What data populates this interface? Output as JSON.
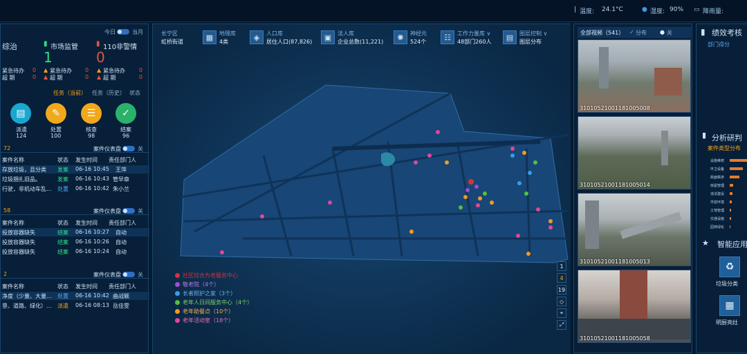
{
  "weather": {
    "temp_label": "温度:",
    "temp": "24.1°C",
    "humidity_label": "湿度:",
    "humidity": "90%",
    "rain_label": "降雨量:"
  },
  "left": {
    "today": "今日",
    "month": "当月",
    "cat1": "综治",
    "cat2": "市场监管",
    "cat3": "110非警情",
    "cat2_value": "1",
    "cat3_value": "0",
    "urgent": "紧急待办",
    "overdue": "超 期",
    "zero": "0",
    "tabs": {
      "current": "任务（当前）",
      "history": "任务（历史）",
      "state": "状态"
    },
    "stages": [
      {
        "label": "派遣",
        "value": "124",
        "color": "#1aa7cf",
        "icon": "document-icon"
      },
      {
        "label": "处置",
        "value": "100",
        "color": "#f2a81c",
        "icon": "wrench-icon"
      },
      {
        "label": "核查",
        "value": "98",
        "color": "#f2a81c",
        "icon": "checklist-icon"
      },
      {
        "label": "结案",
        "value": "96",
        "color": "#2bb26a",
        "icon": "check-icon"
      }
    ],
    "dash_label": "案件仪表盘",
    "off": "关",
    "sections": [
      {
        "count": "72",
        "headers": [
          "案件名称",
          "状态",
          "发生时间",
          "责任部门人"
        ],
        "rows": [
          [
            "存放垃圾，且分类",
            "发案",
            "06-16 10:45",
            "王萍"
          ],
          [
            "垃圾捆扎旧品。",
            "发案",
            "06-16 10:43",
            "管早章"
          ],
          [
            "行驶，非机动车乱...",
            "处置",
            "06-16 10:42",
            "朱小兰"
          ]
        ]
      },
      {
        "count": "58",
        "headers": [
          "案件名称",
          "状态",
          "发生时间",
          "责任部门人"
        ],
        "rows": [
          [
            "投放容器缺失",
            "结案",
            "06-16 10:27",
            "自动"
          ],
          [
            "投放容器缺失",
            "结案",
            "06-16 10:26",
            "自动"
          ],
          [
            "投放容器缺失",
            "结案",
            "06-16 10:24",
            "自动"
          ]
        ]
      },
      {
        "count": "2",
        "headers": [
          "案件名称",
          "状态",
          "发生时间",
          "责任部门人"
        ],
        "rows": [
          [
            "净度（少量、大量...",
            "处置",
            "06-16 10:42",
            "曲战颖"
          ],
          [
            "垦、道路、绿化）...",
            "派遣",
            "06-16 08:13",
            "岳佳雯"
          ]
        ]
      }
    ]
  },
  "map": {
    "district": "长宁区",
    "street": "虹桥街道",
    "stats": [
      {
        "title": "地理库",
        "value": "4类",
        "icon": "map-layer-icon"
      },
      {
        "title": "人口库",
        "value": "居住人口(87,826)",
        "icon": "population-icon"
      },
      {
        "title": "法人库",
        "value": "企业总数(11,221)",
        "icon": "company-icon"
      },
      {
        "title": "神经元",
        "value": "524个",
        "icon": "neuron-icon"
      },
      {
        "title": "工作力量库 ∨",
        "value": "48部门260人",
        "icon": "workforce-icon"
      },
      {
        "title": "图层控制 ∨",
        "value": "图层分布",
        "icon": "layers-icon"
      }
    ],
    "legend": [
      {
        "label": "社区综合为老服务中心",
        "color": "#d8313a"
      },
      {
        "label": "敬老院（4个）",
        "color": "#9b4fd1"
      },
      {
        "label": "长者照护之家（3个）",
        "color": "#3a9be6"
      },
      {
        "label": "老年人日间服务中心（4个）",
        "color": "#52c23a"
      },
      {
        "label": "老年助餐点（10个）",
        "color": "#f29a1f"
      },
      {
        "label": "老年活动室（18个）",
        "color": "#e0479b"
      }
    ],
    "zoom": [
      "1",
      "4",
      "19"
    ]
  },
  "cams": {
    "tab_all": "全部视频（541）",
    "tab_dist": "分布",
    "tab_off": "关",
    "items": [
      {
        "label": "31010521001181005008"
      },
      {
        "label": "31010521001181005014"
      },
      {
        "label": "31010521001181005013"
      },
      {
        "label": "31010521001181005058"
      }
    ]
  },
  "right": {
    "perf_title": "绩效考核",
    "perf_sub": "部门得分",
    "analysis_title": "分析研判",
    "analysis_sub": "案件类型分布",
    "bars": [
      {
        "label": "设施维修",
        "value": 0.95
      },
      {
        "label": "环卫设备",
        "value": 0.72
      },
      {
        "label": "街面秩序",
        "value": 0.55
      },
      {
        "label": "房屋管理",
        "value": 0.2
      },
      {
        "label": "违法建设",
        "value": 0.15
      },
      {
        "label": "市容环境",
        "value": 0.1
      },
      {
        "label": "工地管理",
        "value": 0.08
      },
      {
        "label": "交通设施",
        "value": 0.06
      },
      {
        "label": "园林绿化",
        "value": 0.05
      }
    ],
    "apps_title": "智能应用",
    "app1": "垃圾分类",
    "app2": "明厨亮灶"
  }
}
